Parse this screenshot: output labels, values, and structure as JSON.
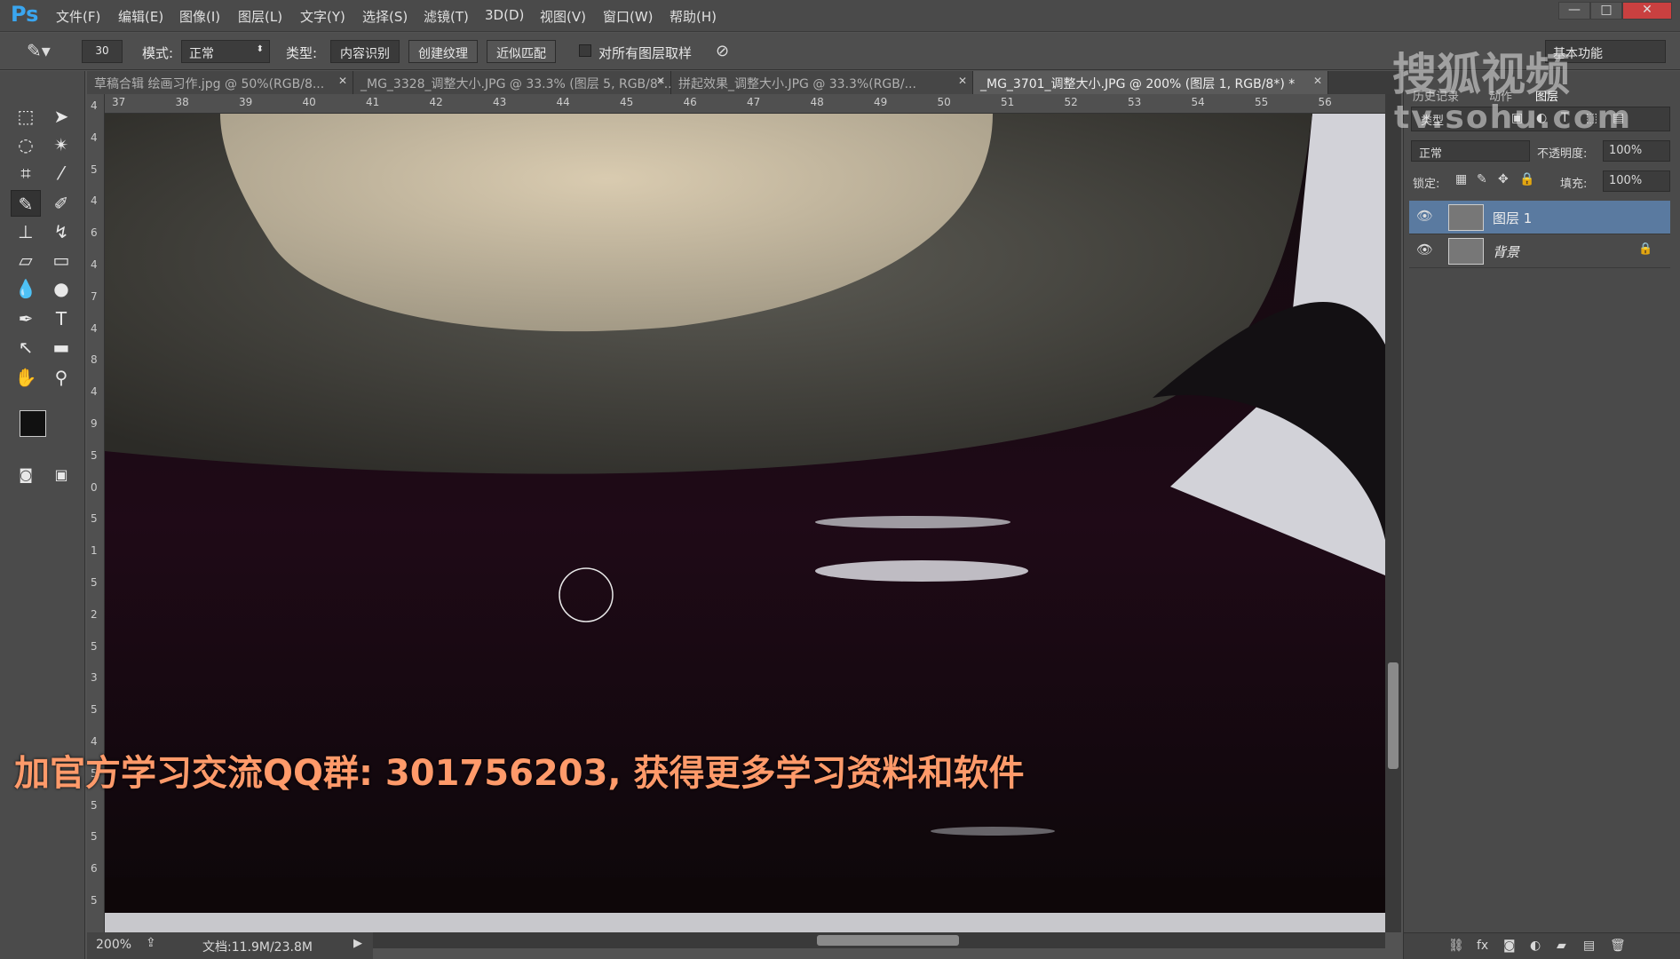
{
  "app": {
    "logo": "Ps"
  },
  "menu": [
    "文件(F)",
    "编辑(E)",
    "图像(I)",
    "图层(L)",
    "文字(Y)",
    "选择(S)",
    "滤镜(T)",
    "3D(D)",
    "视图(V)",
    "窗口(W)",
    "帮助(H)"
  ],
  "window_buttons": [
    "—",
    "□",
    "✕"
  ],
  "options": {
    "brush_size": "30",
    "mode_label": "模式:",
    "mode_value": "正常",
    "type_label": "类型:",
    "type_options": [
      "内容识别",
      "创建纹理",
      "近似匹配"
    ],
    "sample_all_label": "对所有图层取样",
    "workspace": "基本功能"
  },
  "tabs": [
    {
      "label": "草稿合辑 绘画习作.jpg @ 50%(RGB/8..."
    },
    {
      "label": "_MG_3328_调整大小.JPG @ 33.3% (图层 5, RGB/8*..."
    },
    {
      "label": "拼起效果_调整大小.JPG @ 33.3%(RGB/..."
    },
    {
      "label": "_MG_3701_调整大小.JPG @ 200% (图层 1, RGB/8*) *"
    }
  ],
  "ruler_top": [
    "37",
    "38",
    "39",
    "40",
    "41",
    "42",
    "43",
    "44",
    "45",
    "46",
    "47",
    "48",
    "49",
    "50",
    "51",
    "52",
    "53",
    "54",
    "55",
    "56"
  ],
  "ruler_left": [
    "4",
    "4",
    "5",
    "4",
    "6",
    "4",
    "7",
    "4",
    "8",
    "4",
    "9",
    "5",
    "0",
    "5",
    "1",
    "5",
    "2",
    "5",
    "3",
    "5",
    "4",
    "5",
    "5",
    "5",
    "6",
    "5"
  ],
  "status": {
    "zoom": "200%",
    "doc": "文档:11.9M/23.8M"
  },
  "panel": {
    "tabs": [
      "历史记录",
      "动作",
      "图层"
    ],
    "kind_label": "类型",
    "blend_mode": "正常",
    "opacity_label": "不透明度:",
    "opacity_value": "100%",
    "lock_label": "锁定:",
    "fill_label": "填充:",
    "fill_value": "100%",
    "layers": [
      {
        "name": "图层 1",
        "selected": true,
        "locked": false
      },
      {
        "name": "背景",
        "selected": false,
        "locked": true
      }
    ],
    "bottom_icons": [
      "link-icon",
      "fx-icon",
      "mask-icon",
      "adjustment-icon",
      "group-icon",
      "new-layer-icon",
      "trash-icon"
    ]
  },
  "watermark": {
    "brand": "搜狐视频",
    "url": "tv.sohu.com"
  },
  "overlay_text": "加官方学习交流QQ群: 301756203, 获得更多学习资料和软件"
}
